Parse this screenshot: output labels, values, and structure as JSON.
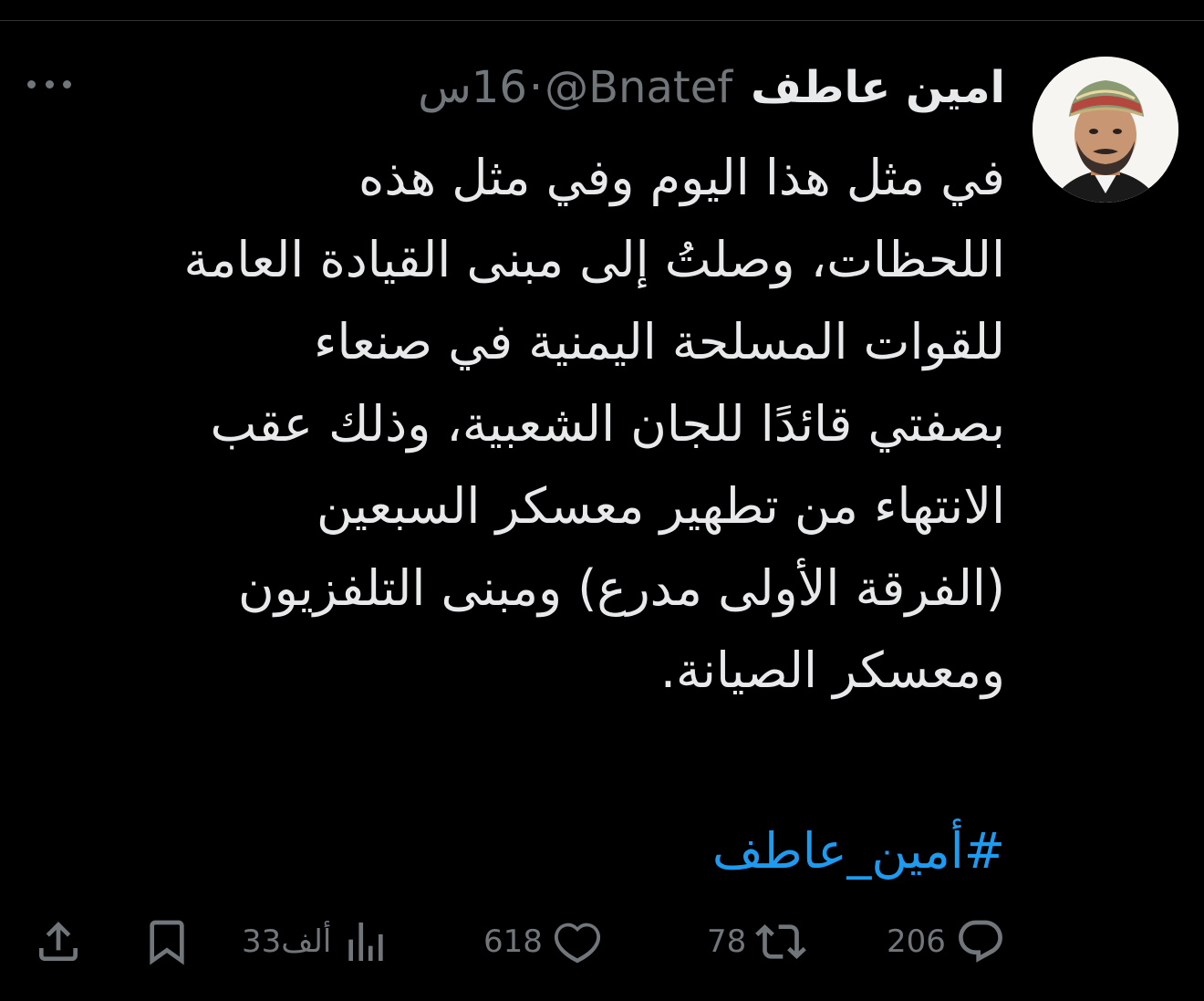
{
  "tweet": {
    "author": {
      "display_name": "امين عاطف",
      "handle": "@Bnatef",
      "separator": "·",
      "time_value": "16",
      "time_unit": "س"
    },
    "body_lines": [
      "في مثل هذا اليوم وفي مثل هذه",
      "اللحظات، وصلتُ إلى مبنى القيادة العامة",
      "للقوات المسلحة اليمنية في صنعاء",
      "بصفتي قائدًا للجان الشعبية، وذلك عقب",
      "الانتهاء من تطهير معسكر السبعين",
      "(الفرقة الأولى مدرع) ومبنى التلفزيون",
      "ومعسكر الصيانة."
    ],
    "hashtag": "#أمين_عاطف",
    "actions": {
      "replies": "206",
      "retweets": "78",
      "likes": "618",
      "views": "33ألف"
    },
    "icons": {
      "more": "more-horizontal-icon",
      "reply": "reply-icon",
      "retweet": "retweet-icon",
      "like": "heart-icon",
      "views": "views-icon",
      "bookmark": "bookmark-icon",
      "share": "share-icon"
    }
  },
  "colors": {
    "background": "#000000",
    "text_primary": "#e7e9ea",
    "text_secondary": "#71767b",
    "link": "#1d9bf0",
    "divider": "#2f3336"
  }
}
